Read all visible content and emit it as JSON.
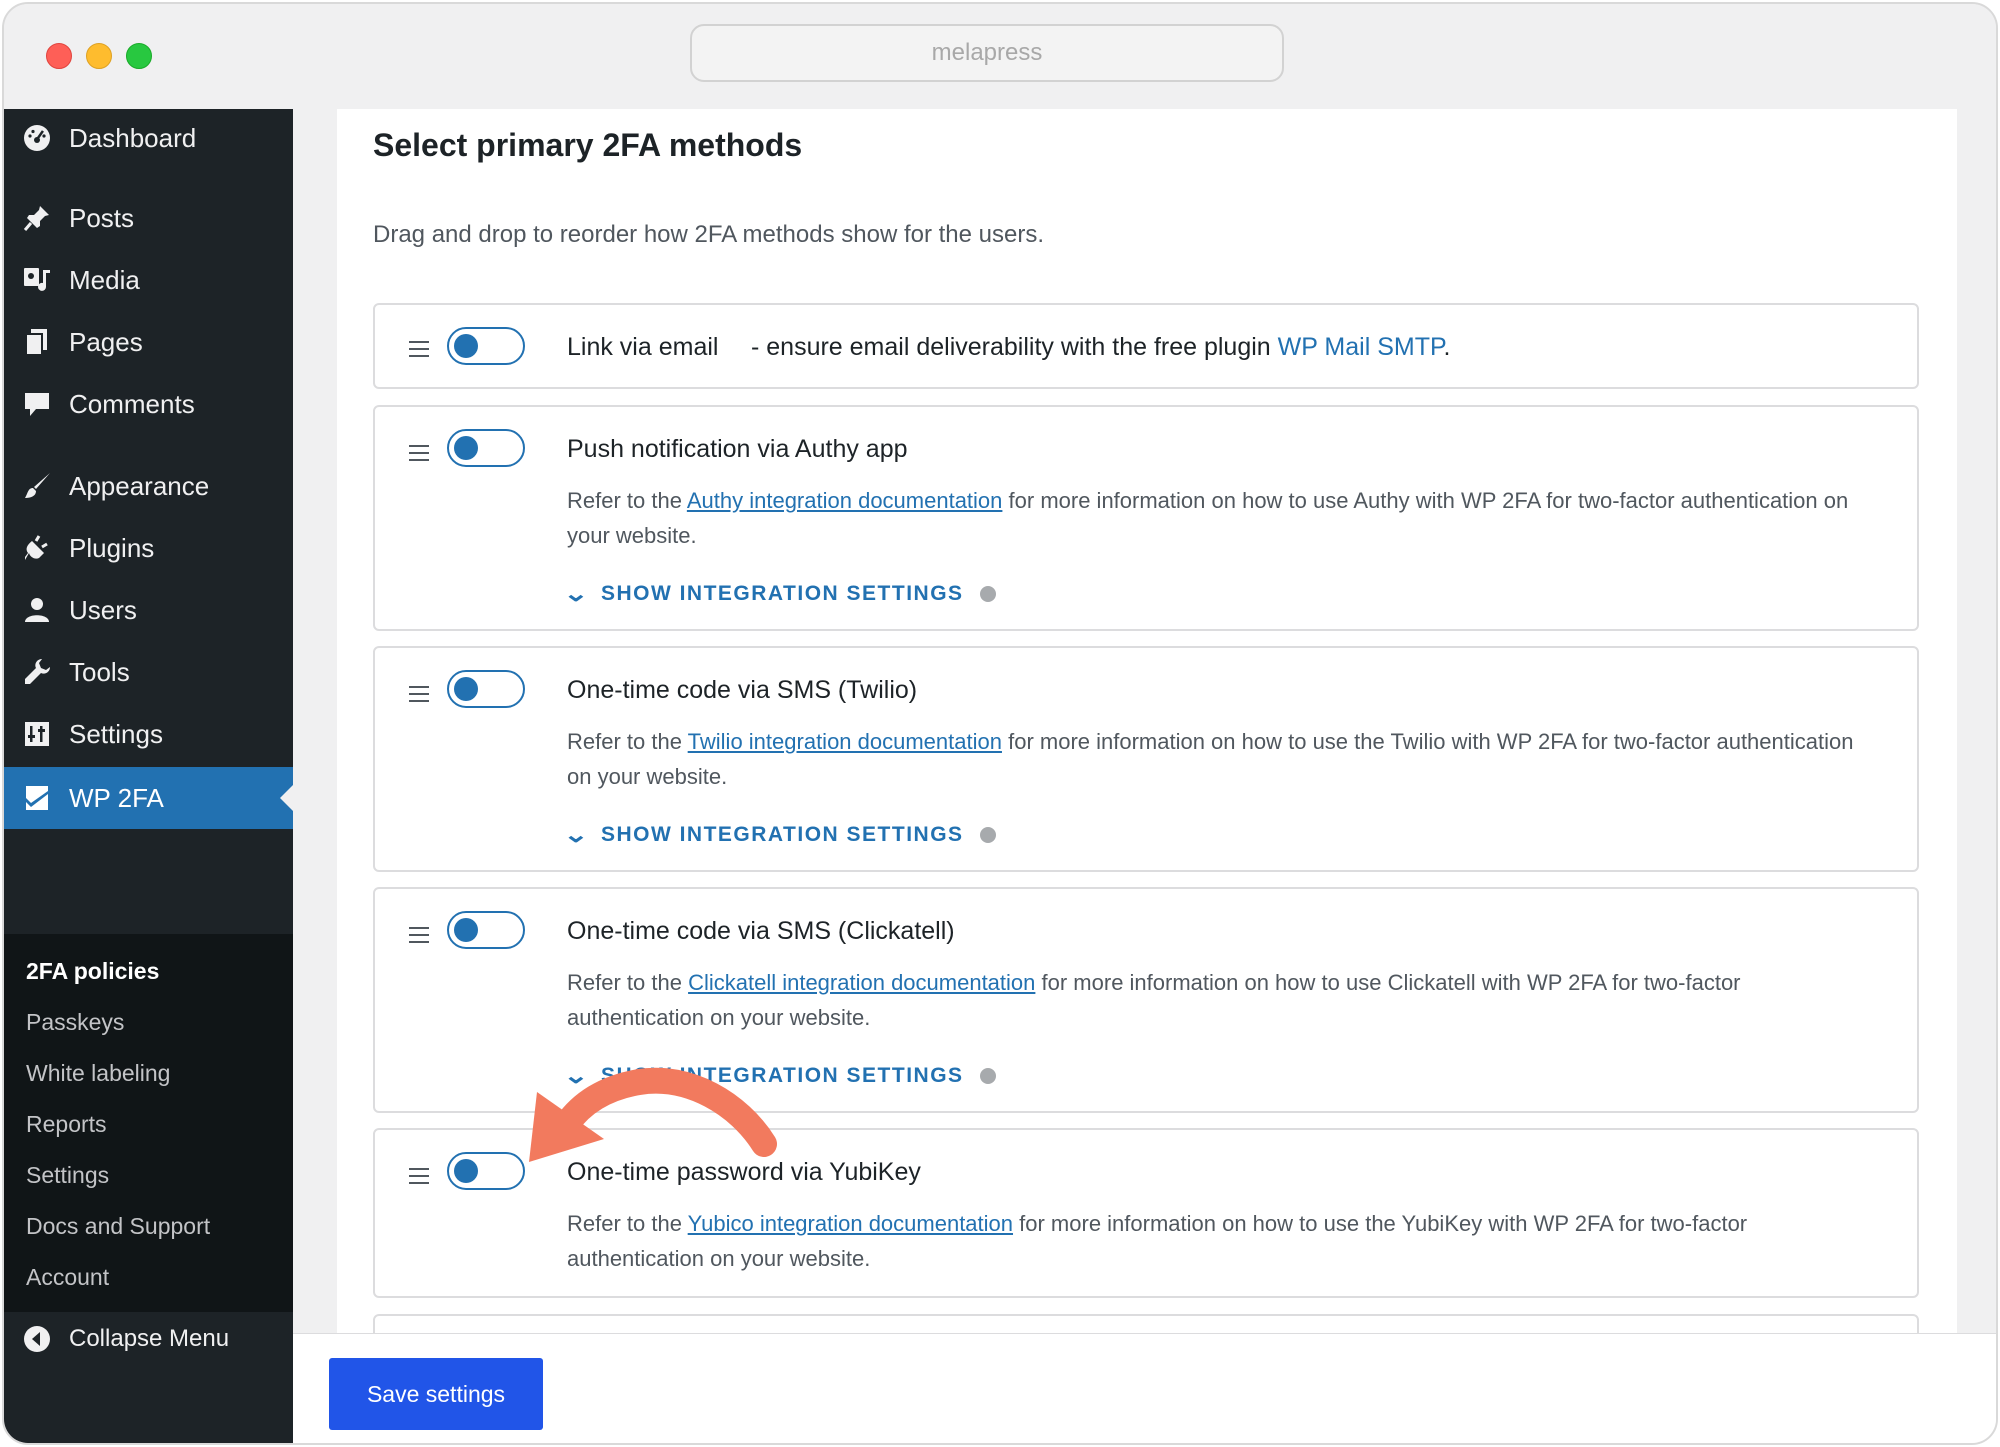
{
  "browser": {
    "url": "melapress"
  },
  "sidebar": {
    "items": [
      {
        "label": "Dashboard",
        "icon": "dashboard-icon"
      },
      {
        "label": "Posts",
        "icon": "pin-icon"
      },
      {
        "label": "Media",
        "icon": "media-icon"
      },
      {
        "label": "Pages",
        "icon": "pages-icon"
      },
      {
        "label": "Comments",
        "icon": "comment-icon"
      },
      {
        "label": "Appearance",
        "icon": "brush-icon"
      },
      {
        "label": "Plugins",
        "icon": "plugin-icon"
      },
      {
        "label": "Users",
        "icon": "user-icon"
      },
      {
        "label": "Tools",
        "icon": "wrench-icon"
      },
      {
        "label": "Settings",
        "icon": "settings-icon"
      },
      {
        "label": "WP 2FA",
        "icon": "wp2fa-icon"
      }
    ],
    "submenu": [
      "2FA policies",
      "Passkeys",
      "White labeling",
      "Reports",
      "Settings",
      "Docs and Support",
      "Account"
    ],
    "collapse_label": "Collapse Menu"
  },
  "panel": {
    "title": "Select primary 2FA methods",
    "description": "Drag and drop to reorder how 2FA methods show for the users.",
    "methods": [
      {
        "title": "Link via email",
        "note_prefix": "- ensure email deliverability with the free plugin",
        "note_link": "WP Mail SMTP",
        "note_suffix": "."
      },
      {
        "title": "Push notification via Authy app",
        "desc_prefix": "Refer to the",
        "desc_link": "Authy integration documentation",
        "desc_suffix": "for more information on how to use Authy with WP 2FA for two-factor authentication on your website.",
        "integration_label": "SHOW INTEGRATION SETTINGS"
      },
      {
        "title": "One-time code via SMS (Twilio)",
        "desc_prefix": "Refer to the",
        "desc_link": "Twilio integration documentation",
        "desc_suffix": "for more information on how to use the Twilio with WP 2FA for two-factor authentication on your website.",
        "integration_label": "SHOW INTEGRATION SETTINGS"
      },
      {
        "title": "One-time code via SMS (Clickatell)",
        "desc_prefix": "Refer to the",
        "desc_link": "Clickatell integration documentation",
        "desc_suffix": "for more information on how to use Clickatell with WP 2FA for two-factor authentication on your website.",
        "integration_label": "SHOW INTEGRATION SETTINGS"
      },
      {
        "title": "One-time password via YubiKey",
        "desc_prefix": "Refer to the",
        "desc_link": "Yubico integration documentation",
        "desc_suffix": "for more information on how to use the YubiKey with WP 2FA for two-factor authentication on your website."
      }
    ]
  },
  "footer": {
    "save_label": "Save settings"
  },
  "colors": {
    "accent": "#2271b1",
    "save_button": "#2155e8",
    "sidebar": "#1d2327",
    "annotation_arrow": "#f27a5e"
  }
}
